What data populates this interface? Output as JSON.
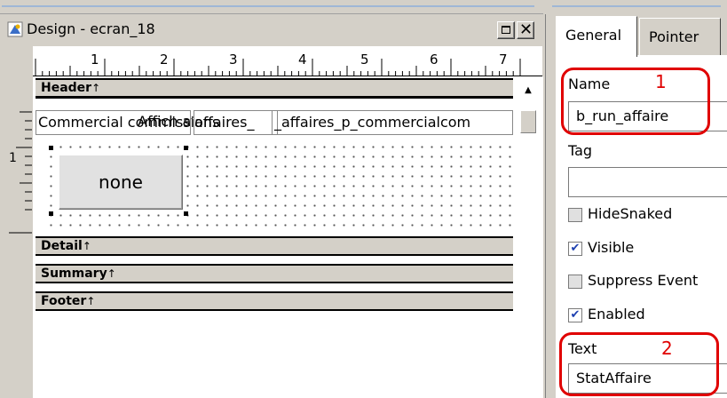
{
  "design_window": {
    "title": "Design - ecran_18",
    "ruler_marks": [
      "1",
      "2",
      "3",
      "4",
      "5",
      "6",
      "7"
    ],
    "vertical_ruler_marks": [
      "1"
    ],
    "bands": {
      "header": "Header",
      "detail": "Detail",
      "summary": "Summary",
      "footer": "Footer"
    },
    "band_arrow": "↑",
    "fields": {
      "commercial": "Commercial commissions",
      "affichaff": "Affich affaires",
      "affaires": "affaires_",
      "query": "_affaires_p_commercialcom"
    },
    "button_label": "none"
  },
  "properties": {
    "tabs": [
      "General",
      "Pointer"
    ],
    "name_label": "Name",
    "name_value": "b_run_affaire",
    "tag_label": "Tag",
    "tag_value": "",
    "checkboxes": [
      {
        "label": "HideSnaked",
        "checked": false
      },
      {
        "label": "Visible",
        "checked": true
      },
      {
        "label": "Suppress Event",
        "checked": false
      },
      {
        "label": "Enabled",
        "checked": true
      }
    ],
    "text_label": "Text",
    "text_value": "StatAffaire"
  },
  "callouts": [
    "1",
    "2"
  ],
  "colors": {
    "callout": "#e00000",
    "checkmark": "#1c3fb0"
  }
}
